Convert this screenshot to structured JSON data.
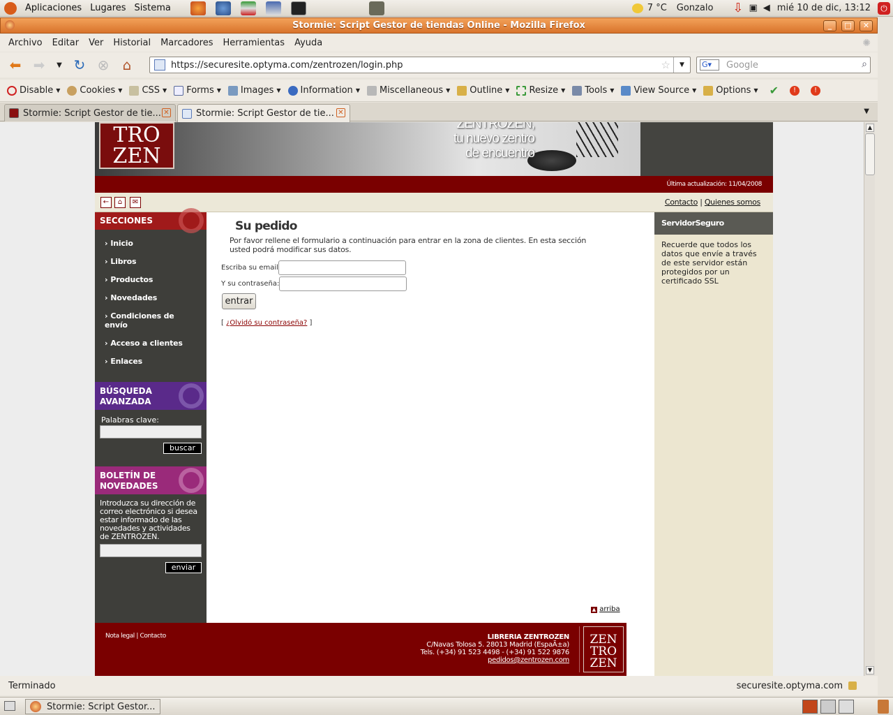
{
  "panel": {
    "menus": [
      "Aplicaciones",
      "Lugares",
      "Sistema"
    ],
    "weather": "7 °C",
    "user": "Gonzalo",
    "clock": "mié 10 de dic, 13:12"
  },
  "window": {
    "title": "Stormie: Script Gestor de tiendas Online - Mozilla Firefox"
  },
  "menubar": [
    "Archivo",
    "Editar",
    "Ver",
    "Historial",
    "Marcadores",
    "Herramientas",
    "Ayuda"
  ],
  "nav": {
    "url": "https://securesite.optyma.com/zentrozen/login.php",
    "search_placeholder": "Google"
  },
  "devtoolbar": [
    "Disable",
    "Cookies",
    "CSS",
    "Forms",
    "Images",
    "Information",
    "Miscellaneous",
    "Outline",
    "Resize",
    "Tools",
    "View Source",
    "Options"
  ],
  "tabs": [
    {
      "label": "Stormie: Script Gestor de tie..."
    },
    {
      "label": "Stormie: Script Gestor de tie..."
    }
  ],
  "site": {
    "logo_lines": [
      "TRO",
      "ZEN"
    ],
    "slogan": [
      "ZENTROZEN,",
      "tu nuevo zentro",
      "de encuentro"
    ],
    "last_update": "Última actualización: 11/04/2008",
    "top_links": [
      "Contacto",
      "Quienes somos"
    ],
    "sections_title": "SECCIONES",
    "nav_links": [
      "Inicio",
      "Libros",
      "Productos",
      "Novedades",
      "Condiciones de envío",
      "Acceso a clientes",
      "Enlaces"
    ],
    "search_title": "BÚSQUEDA AVANZADA",
    "search_label": "Palabras clave:",
    "search_button": "buscar",
    "newsletter_title": "BOLETÍN DE NOVEDADES",
    "newsletter_text": "Introduzca su dirección de correo electrónico si desea estar informado de las novedades y actividades de ZENTROZEN.",
    "newsletter_button": "enviar",
    "main": {
      "title": "Su pedido",
      "intro": "Por favor rellene el formulario a continuación para entrar en la zona de clientes. En esta sección usted podrá modificar sus datos.",
      "email_label": "Escriba su email:",
      "password_label": "Y su contraseña:",
      "submit": "entrar",
      "forgot": "¿Olvidó su contraseña?",
      "top_link": "arriba"
    },
    "right": {
      "title": "ServidorSeguro",
      "text": "Recuerde que todos los datos que envíe a través de este servidor están protegidos por un certificado SSL"
    },
    "footer": {
      "links": [
        "Nota legal",
        "Contacto"
      ],
      "company": "LIBRERIA ZENTROZEN",
      "address": "C/Navas Tolosa 5. 28013 Madrid (EspaÃ±a)",
      "phones": "Tels. (+34) 91 523 4498 - (+34) 91 522 9876",
      "email": "pedidos@zentrozen.com",
      "logo_lines": [
        "ZEN",
        "TRO",
        "ZEN"
      ]
    }
  },
  "status": {
    "left": "Terminado",
    "right": "securesite.optyma.com"
  },
  "taskbar": {
    "task": "Stormie: Script Gestor..."
  }
}
